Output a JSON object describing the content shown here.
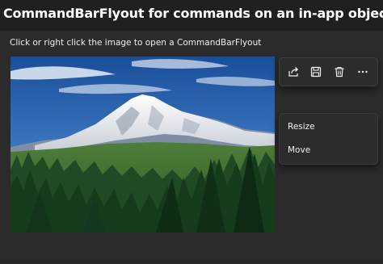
{
  "header": {
    "title": "CommandBarFlyout for commands on an in-app object"
  },
  "content": {
    "instructions": "Click or right click the image to open a CommandBarFlyout",
    "image_alt": "Snow-capped mountain above an evergreen forest"
  },
  "command_bar": {
    "primary_commands": [
      {
        "icon": "share-icon"
      },
      {
        "icon": "save-icon"
      },
      {
        "icon": "delete-icon"
      },
      {
        "icon": "more-icon"
      }
    ],
    "secondary_commands": [
      {
        "label": "Resize"
      },
      {
        "label": "Move"
      }
    ]
  },
  "colors": {
    "background": "#202020",
    "panel": "#2b2b2b",
    "flyout": "#2c2c2c",
    "text": "#ffffff"
  }
}
